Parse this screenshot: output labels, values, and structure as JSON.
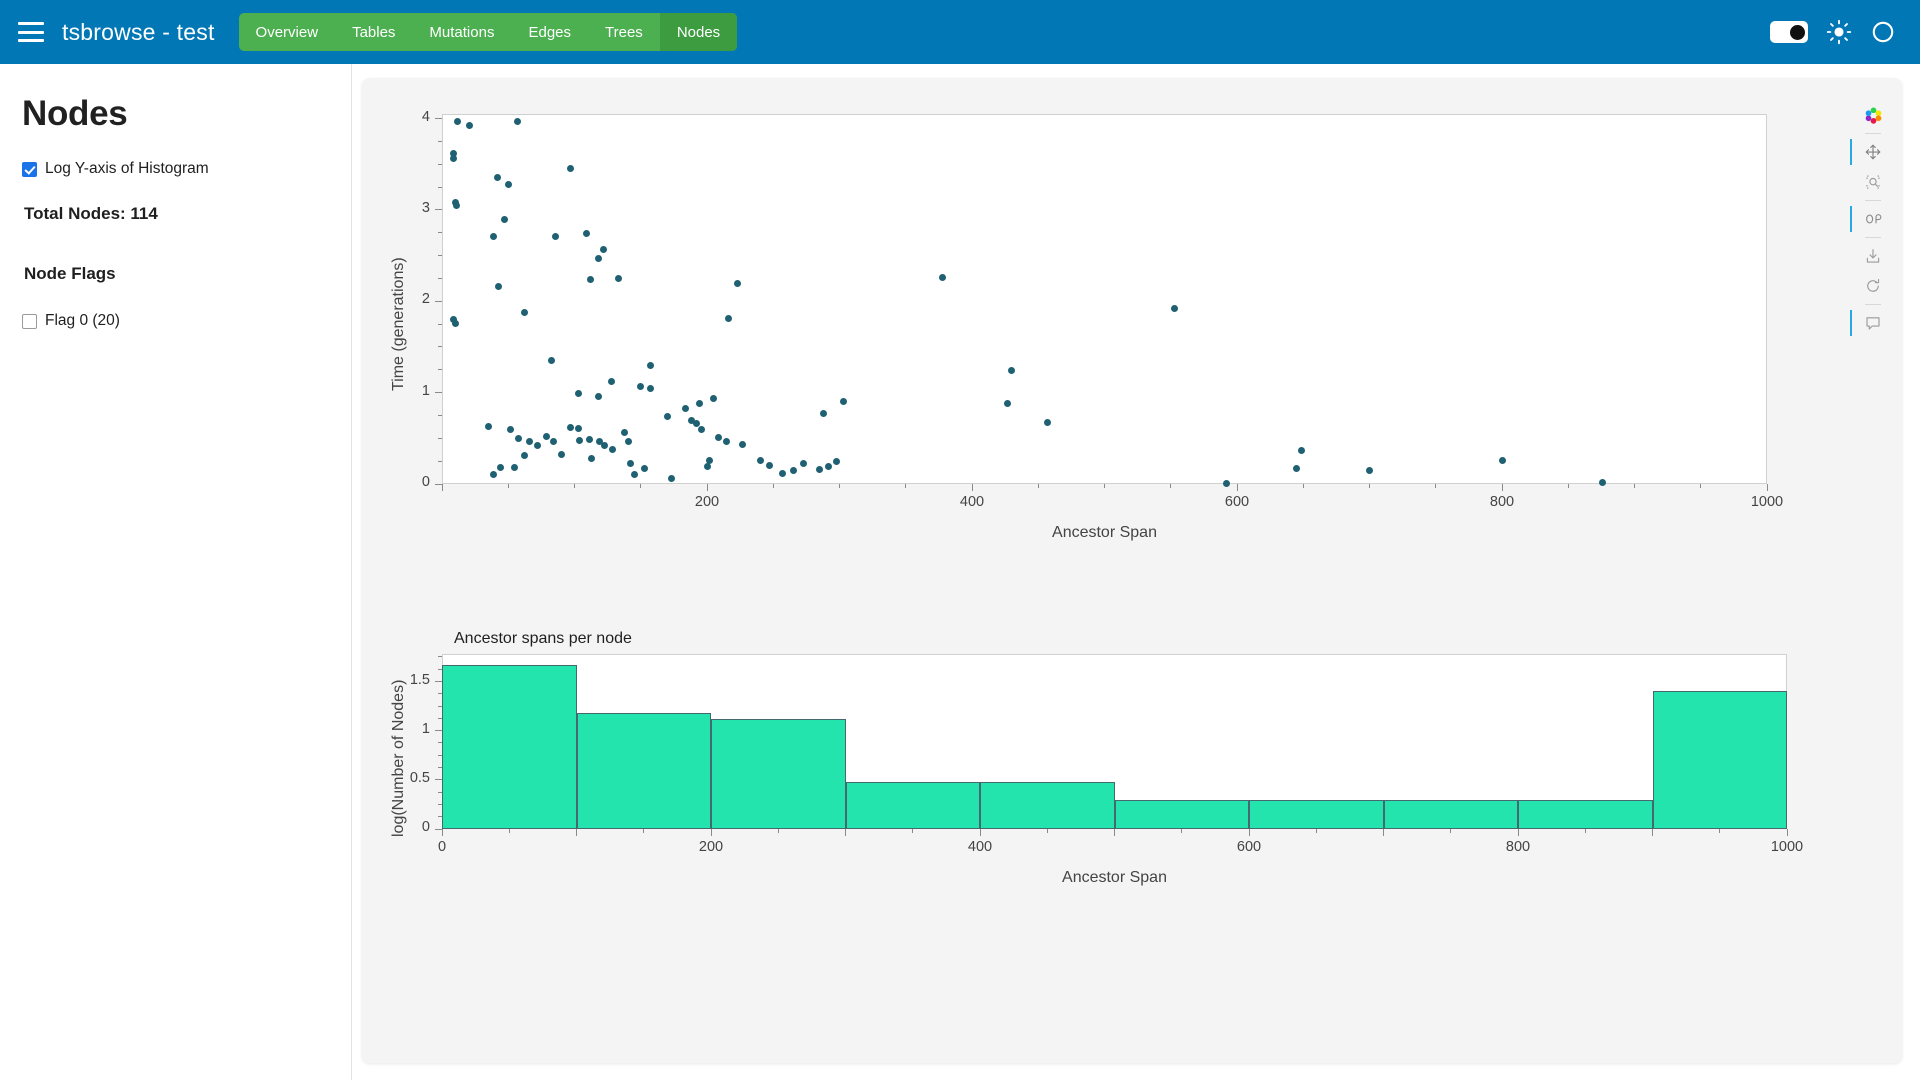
{
  "navbar": {
    "menu_icon": "hamburger-icon",
    "title": "tsbrowse  -  test",
    "tabs": [
      {
        "label": "Overview",
        "active": false
      },
      {
        "label": "Tables",
        "active": false
      },
      {
        "label": "Mutations",
        "active": false
      },
      {
        "label": "Edges",
        "active": false
      },
      {
        "label": "Trees",
        "active": false
      },
      {
        "label": "Nodes",
        "active": true
      }
    ],
    "right_controls": [
      {
        "name": "theme-toggle",
        "state": "on"
      },
      {
        "name": "sun-icon"
      },
      {
        "name": "loading-circle-icon"
      }
    ],
    "colors": {
      "bar": "#0277b6",
      "tabs": "#4caf50",
      "tab_active": "#3d9c40"
    }
  },
  "sidebar": {
    "page_title": "Nodes",
    "log_checkbox": {
      "label": "Log Y-axis of Histogram",
      "checked": true
    },
    "total_nodes": "Total Nodes: 114",
    "flags_header": "Node Flags",
    "flags": [
      {
        "label": "Flag 0 (20)",
        "checked": false
      }
    ]
  },
  "toolbar": {
    "items": [
      {
        "name": "bokeh-logo-icon",
        "label": "Bokeh",
        "active": false
      },
      {
        "name": "pan-tool-icon",
        "label": "Pan",
        "active": true
      },
      {
        "name": "box-zoom-tool-icon",
        "label": "Box Zoom",
        "active": false
      },
      {
        "name": "wheel-zoom-tool-icon",
        "label": "Wheel Zoom",
        "active": true
      },
      {
        "name": "save-tool-icon",
        "label": "Save",
        "active": false
      },
      {
        "name": "reset-tool-icon",
        "label": "Reset",
        "active": false
      },
      {
        "name": "hover-tool-icon",
        "label": "Hover",
        "active": true
      }
    ]
  },
  "chart_data": [
    {
      "type": "scatter",
      "title": "",
      "xlabel": "Ancestor Span",
      "ylabel": "Time (generations)",
      "xlim": [
        0,
        1000
      ],
      "ylim": [
        0,
        4.05
      ],
      "xticks": [
        200,
        400,
        600,
        800,
        1000
      ],
      "yticks": [
        0,
        1,
        2,
        3,
        4
      ],
      "grid": false,
      "marker_color": "#1f6173",
      "points": [
        [
          12,
          3.97
        ],
        [
          9,
          3.62
        ],
        [
          9,
          3.56
        ],
        [
          21,
          3.92
        ],
        [
          57,
          3.97
        ],
        [
          10,
          3.08
        ],
        [
          11,
          3.05
        ],
        [
          42,
          3.35
        ],
        [
          50,
          3.28
        ],
        [
          47,
          2.9
        ],
        [
          97,
          3.45
        ],
        [
          39,
          2.71
        ],
        [
          86,
          2.71
        ],
        [
          109,
          2.74
        ],
        [
          122,
          2.57
        ],
        [
          118,
          2.47
        ],
        [
          43,
          2.16
        ],
        [
          112,
          2.24
        ],
        [
          133,
          2.25
        ],
        [
          378,
          2.26
        ],
        [
          553,
          1.92
        ],
        [
          223,
          2.2
        ],
        [
          62,
          1.88
        ],
        [
          9,
          1.8
        ],
        [
          10,
          1.76
        ],
        [
          83,
          1.35
        ],
        [
          216,
          1.81
        ],
        [
          157,
          1.3
        ],
        [
          430,
          1.24
        ],
        [
          128,
          1.12
        ],
        [
          103,
          0.99
        ],
        [
          118,
          0.96
        ],
        [
          150,
          1.07
        ],
        [
          157,
          1.04
        ],
        [
          205,
          0.94
        ],
        [
          194,
          0.88
        ],
        [
          303,
          0.9
        ],
        [
          288,
          0.77
        ],
        [
          427,
          0.88
        ],
        [
          649,
          0.37
        ],
        [
          800,
          0.26
        ],
        [
          700,
          0.15
        ],
        [
          457,
          0.67
        ],
        [
          35,
          0.63
        ],
        [
          52,
          0.6
        ],
        [
          97,
          0.62
        ],
        [
          103,
          0.61
        ],
        [
          58,
          0.5
        ],
        [
          66,
          0.47
        ],
        [
          79,
          0.52
        ],
        [
          84,
          0.46
        ],
        [
          72,
          0.42
        ],
        [
          104,
          0.48
        ],
        [
          111,
          0.49
        ],
        [
          119,
          0.47
        ],
        [
          123,
          0.42
        ],
        [
          129,
          0.38
        ],
        [
          170,
          0.74
        ],
        [
          184,
          0.83
        ],
        [
          138,
          0.56
        ],
        [
          141,
          0.46
        ],
        [
          188,
          0.7
        ],
        [
          192,
          0.66
        ],
        [
          196,
          0.6
        ],
        [
          209,
          0.51
        ],
        [
          215,
          0.46
        ],
        [
          227,
          0.43
        ],
        [
          62,
          0.31
        ],
        [
          90,
          0.32
        ],
        [
          113,
          0.28
        ],
        [
          142,
          0.22
        ],
        [
          153,
          0.17
        ],
        [
          173,
          0.06
        ],
        [
          200,
          0.19
        ],
        [
          202,
          0.26
        ],
        [
          240,
          0.26
        ],
        [
          247,
          0.2
        ],
        [
          257,
          0.11
        ],
        [
          265,
          0.15
        ],
        [
          273,
          0.22
        ],
        [
          285,
          0.16
        ],
        [
          292,
          0.19
        ],
        [
          298,
          0.25
        ],
        [
          592,
          0.01
        ],
        [
          876,
          0.02
        ],
        [
          645,
          0.17
        ],
        [
          39,
          0.1
        ],
        [
          44,
          0.18
        ],
        [
          55,
          0.18
        ],
        [
          145,
          0.1
        ]
      ]
    },
    {
      "type": "bar",
      "title": "Ancestor spans per node",
      "xlabel": "Ancestor Span",
      "ylabel": "log(Number of Nodes)",
      "xlim": [
        0,
        1000
      ],
      "ylim": [
        0,
        1.78
      ],
      "xticks": [
        0,
        200,
        400,
        600,
        800,
        1000
      ],
      "yticks": [
        0,
        0.5,
        1,
        1.5
      ],
      "grid": false,
      "bar_color": "#22e4ac",
      "bar_line_color": "#45696f",
      "bin_edges": [
        0,
        100,
        200,
        300,
        400,
        500,
        600,
        700,
        800,
        900,
        1000
      ],
      "values": [
        1.67,
        1.18,
        1.12,
        0.48,
        0.48,
        0.3,
        0.3,
        0.3,
        0.3,
        1.4
      ]
    }
  ]
}
